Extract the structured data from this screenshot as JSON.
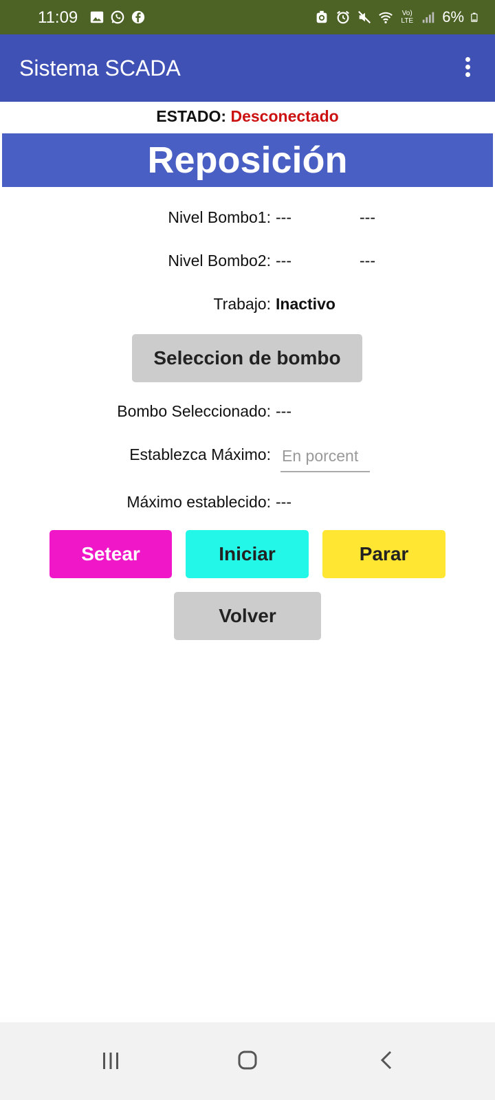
{
  "status_bar": {
    "time": "11:09",
    "battery": "6%",
    "left_icons": [
      "gallery-icon",
      "whatsapp-icon",
      "facebook-icon"
    ],
    "right_icons": [
      "sync-icon",
      "alarm-icon",
      "mute-icon",
      "wifi-icon",
      "volte-icon",
      "signal-icon",
      "battery-icon"
    ],
    "network_label": "Vo) LTE"
  },
  "app_bar": {
    "title": "Sistema SCADA",
    "menu_icon": "more-vert-icon"
  },
  "estado": {
    "label": "ESTADO:",
    "value": "Desconectado",
    "value_color": "#cc1111"
  },
  "banner": {
    "title": "Reposición",
    "color": "#4a5fc4"
  },
  "rows": {
    "nivel1": {
      "label": "Nivel Bombo1:",
      "value": "---",
      "value2": "---"
    },
    "nivel2": {
      "label": "Nivel Bombo2:",
      "value": "---",
      "value2": "---"
    },
    "trabajo": {
      "label": "Trabajo:",
      "value": "Inactivo"
    },
    "bombo_sel": {
      "label": "Bombo Seleccionado:",
      "value": "---"
    },
    "establezca": {
      "label": "Establezca Máximo:"
    },
    "max_est": {
      "label": "Máximo establecido:",
      "value": "---"
    }
  },
  "input": {
    "placeholder": "En porcent",
    "value": ""
  },
  "buttons": {
    "seleccion": "Seleccion de bombo",
    "setear": "Setear",
    "iniciar": "Iniciar",
    "parar": "Parar",
    "volver": "Volver"
  },
  "colors": {
    "status_bar": "#4d6325",
    "app_bar": "#3f51b5",
    "setear": "#f017c8",
    "iniciar": "#22f7e8",
    "parar": "#fee633",
    "gray_button": "#cccccc"
  },
  "nav": {
    "icons": [
      "recents-icon",
      "home-icon",
      "back-icon"
    ]
  }
}
